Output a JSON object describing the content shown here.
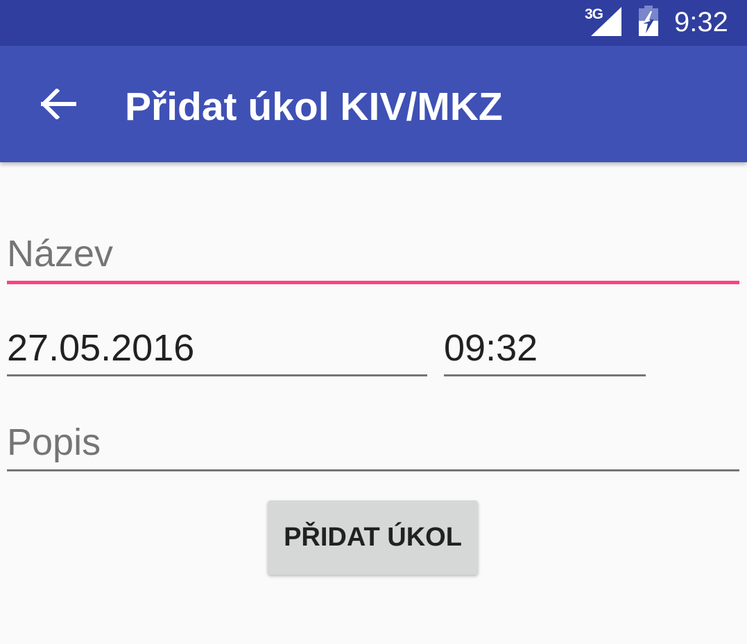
{
  "status_bar": {
    "network_label": "3G",
    "signal_icon": "signal-icon",
    "battery_icon": "battery-charging-icon",
    "time": "9:32",
    "background_color": "#303f9f"
  },
  "app_bar": {
    "back_icon": "back-arrow-icon",
    "title": "Přidat úkol KIV/MKZ",
    "background_color": "#3f51b5"
  },
  "form": {
    "name": {
      "value": "",
      "placeholder": "Název",
      "focused": true
    },
    "date": {
      "value": "27.05.2016"
    },
    "time": {
      "value": "09:32"
    },
    "description": {
      "value": "",
      "placeholder": "Popis"
    },
    "submit_label": "PŘIDAT ÚKOL"
  },
  "colors": {
    "accent": "#ff4081",
    "primary": "#3f51b5",
    "primary_dark": "#303f9f",
    "background": "#fafafa"
  }
}
